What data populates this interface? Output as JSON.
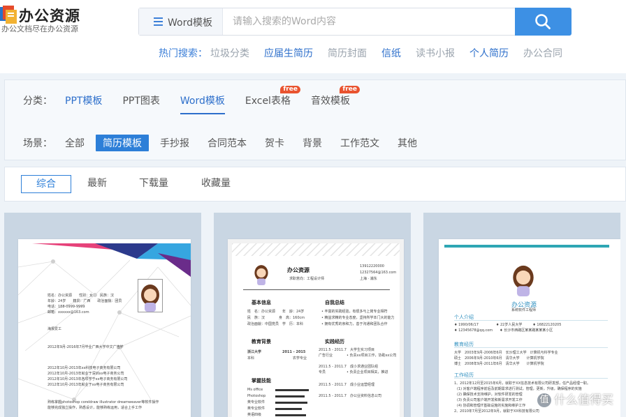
{
  "header": {
    "logo_title": "办公资源",
    "logo_subtitle": "办公文档尽在办公资源",
    "search": {
      "category": "Word模板",
      "placeholder": "请输入搜索的Word内容"
    },
    "hot": {
      "label": "热门搜索：",
      "items": [
        {
          "text": "垃圾分类",
          "style": "gray"
        },
        {
          "text": "应届生简历",
          "style": "blue"
        },
        {
          "text": "简历封面",
          "style": "gray"
        },
        {
          "text": "信纸",
          "style": "blue"
        },
        {
          "text": "读书小报",
          "style": "gray"
        },
        {
          "text": "个人简历",
          "style": "blue"
        },
        {
          "text": "办公合同",
          "style": "gray"
        }
      ]
    }
  },
  "filters": {
    "category_label": "分类：",
    "categories": [
      {
        "text": "PPT模板",
        "state": "blue"
      },
      {
        "text": "PPT图表",
        "state": "normal"
      },
      {
        "text": "Word模板",
        "state": "active"
      },
      {
        "text": "Excel表格",
        "state": "normal",
        "badge": "free"
      },
      {
        "text": "音效模板",
        "state": "normal",
        "badge": "free"
      }
    ],
    "scene_label": "场景：",
    "scenes": [
      {
        "text": "全部",
        "selected": false
      },
      {
        "text": "简历模板",
        "selected": true
      },
      {
        "text": "手抄报",
        "selected": false
      },
      {
        "text": "合同范本",
        "selected": false
      },
      {
        "text": "贺卡",
        "selected": false
      },
      {
        "text": "背景",
        "selected": false
      },
      {
        "text": "工作范文",
        "selected": false
      },
      {
        "text": "其他",
        "selected": false
      }
    ]
  },
  "sort": {
    "tabs": [
      "综合",
      "最新",
      "下载量",
      "收藏量"
    ],
    "active": "综合"
  },
  "cards": {
    "card2": {
      "name": "办公资源",
      "subtitle": "求职意向：工程设计师",
      "phone": "13912220000",
      "email": "12327564@163.com",
      "location": "上海 · 浦东",
      "sections": {
        "basic": "基本信息",
        "self": "自我总结",
        "edu": "教育背景",
        "exp": "实践经历",
        "skill": "掌握技能"
      }
    },
    "card3": {
      "name": "办公资源",
      "title": "系统软件工程师",
      "sections": {
        "intro": "个人介绍",
        "edu": "教育经历",
        "work": "工作经历"
      }
    }
  },
  "watermark": "值 什么值得买",
  "colors": {
    "brand_blue": "#3d90e4",
    "link_blue": "#2d6fcb",
    "free_badge": "#e9532f",
    "card_bg": "#c9d6e3"
  }
}
